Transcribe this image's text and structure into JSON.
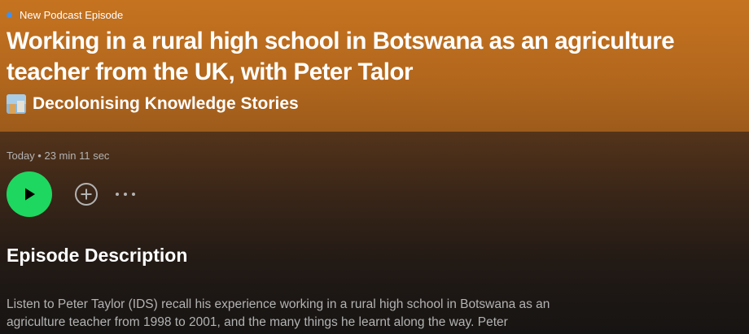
{
  "badge": {
    "label": "New Podcast Episode",
    "dot_color": "#3d91f4"
  },
  "episode": {
    "title": "Working in a rural high school in Botswana as an agriculture teacher from the UK, with Peter Talor",
    "show_name": "Decolonising Knowledge Stories",
    "meta": "Today • 23 min 11 sec"
  },
  "controls": {
    "play_icon": "play-icon",
    "add_icon": "plus-circle-icon",
    "more_icon": "more-icon",
    "play_color": "#1ed760"
  },
  "description": {
    "heading": "Episode Description",
    "text": "Listen to Peter Taylor (IDS) recall his experience working in a rural high school in Botswana as an agriculture teacher from 1998 to 2001, and the many things he learnt along the way. Peter"
  },
  "colors": {
    "header_accent": "#c5731f",
    "background": "#121212"
  }
}
